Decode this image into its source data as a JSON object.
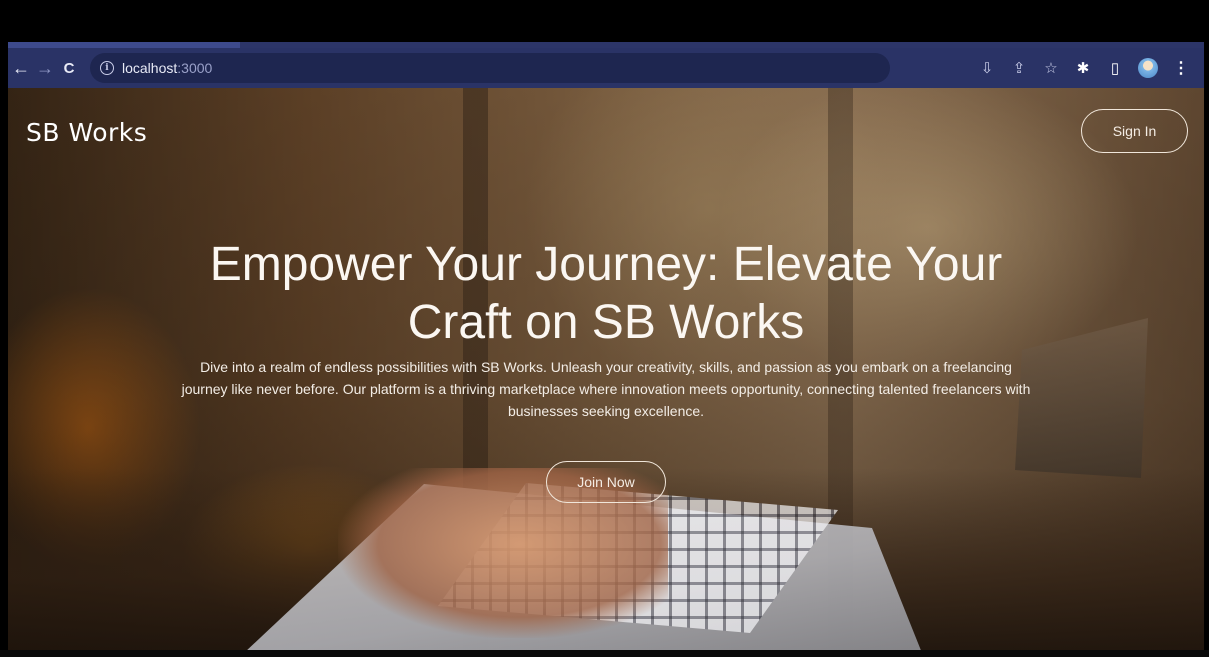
{
  "browser": {
    "url_host": "localhost",
    "url_port": ":3000",
    "icons": [
      "back-icon",
      "forward-icon",
      "reload-icon",
      "info-icon",
      "install-icon",
      "share-icon",
      "star-icon",
      "extensions-icon",
      "sidepanel-icon",
      "profile-avatar",
      "menu-icon"
    ],
    "glyphs": {
      "back": "←",
      "forward": "→",
      "reload": "C",
      "info": "i",
      "install": "⇩",
      "share": "⇪",
      "star": "☆",
      "extensions": "✱",
      "sidepanel": "▯",
      "menu": "⋮"
    }
  },
  "page": {
    "brand": "SB Works",
    "sign_in_label": "Sign In",
    "headline": "Empower Your Journey: Elevate Your Craft on SB Works",
    "intro": "Dive into a realm of endless possibilities with SB Works. Unleash your creativity, skills, and passion as you embark on a freelancing journey like never before. Our platform is a thriving marketplace where innovation meets opportunity, connecting talented freelancers with businesses seeking excellence.",
    "join_now_label": "Join Now"
  },
  "colors": {
    "toolbar": "#2a3366",
    "omnibox": "#1e2650",
    "text_light": "#fbf7f2"
  }
}
